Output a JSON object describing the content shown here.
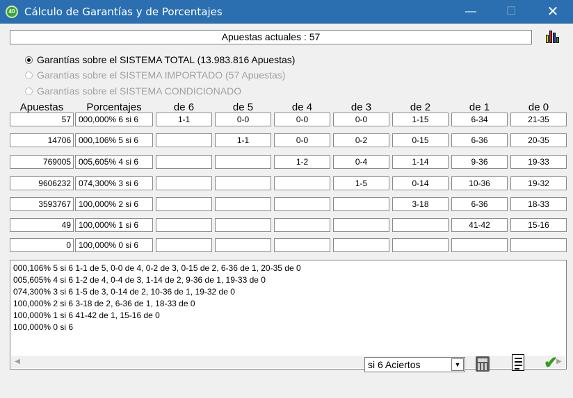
{
  "window": {
    "title": "Cálculo de Garantías y de Porcentajes",
    "minimize": "—",
    "maximize": "☐",
    "close": "✕"
  },
  "current_bets": "Apuestas actuales : 57",
  "options": [
    {
      "label": "Garantías sobre el SISTEMA TOTAL (13.983.816 Apuestas)",
      "selected": true,
      "enabled": true
    },
    {
      "label": "Garantías sobre el SISTEMA IMPORTADO (57 Apuestas)",
      "selected": false,
      "enabled": false
    },
    {
      "label": "Garantías sobre el SISTEMA CONDICIONADO",
      "selected": false,
      "enabled": false
    }
  ],
  "table": {
    "headers": [
      "Apuestas",
      "Porcentajes",
      "de 6",
      "de 5",
      "de 4",
      "de 3",
      "de 2",
      "de 1",
      "de 0"
    ],
    "rows": [
      [
        "57",
        "000,000% 6 si 6",
        "1-1",
        "0-0",
        "0-0",
        "0-0",
        "1-15",
        "6-34",
        "21-35"
      ],
      [
        "14706",
        "000,106% 5 si 6",
        "",
        "1-1",
        "0-0",
        "0-2",
        "0-15",
        "6-36",
        "20-35"
      ],
      [
        "769005",
        "005,605% 4 si 6",
        "",
        "",
        "1-2",
        "0-4",
        "1-14",
        "9-36",
        "19-33"
      ],
      [
        "9606232",
        "074,300% 3 si 6",
        "",
        "",
        "",
        "1-5",
        "0-14",
        "10-36",
        "19-32"
      ],
      [
        "3593767",
        "100,000% 2 si 6",
        "",
        "",
        "",
        "",
        "3-18",
        "6-36",
        "18-33"
      ],
      [
        "49",
        "100,000% 1 si 6",
        "",
        "",
        "",
        "",
        "",
        "41-42",
        "15-16"
      ],
      [
        "0",
        "100,000% 0 si 6",
        "",
        "",
        "",
        "",
        "",
        "",
        ""
      ]
    ]
  },
  "results": [
    "000,106% 5 si 6  1-1 de 5, 0-0 de 4, 0-2 de 3, 0-15 de 2, 6-36 de 1, 20-35 de 0",
    "005,605% 4 si 6  1-2 de 4, 0-4 de 3, 1-14 de 2, 9-36 de 1, 19-33 de 0",
    "074,300% 3 si 6  1-5 de 3, 0-14 de 2, 10-36 de 1, 19-32 de 0",
    "100,000% 2 si 6  3-18 de 2, 6-36 de 1, 18-33 de 0",
    "100,000% 1 si 6  41-42 de 1, 15-16 de 0",
    "100,000% 0 si 6"
  ],
  "scroll_left": "◀",
  "scroll_right": "▶",
  "combo": {
    "value": "si 6 Aciertos",
    "arrow": "▼"
  },
  "icons": {
    "chart": "bar-chart-icon",
    "calculator": "calculator-icon",
    "report": "report-icon",
    "accept": "check-icon"
  },
  "check_glyph": "✔",
  "colors": {
    "titlebar": "#2b6fb0",
    "check": "#2e9d1a",
    "chart_bars": [
      "#f0d000",
      "#d02020",
      "#2040c0",
      "#20a020"
    ]
  }
}
